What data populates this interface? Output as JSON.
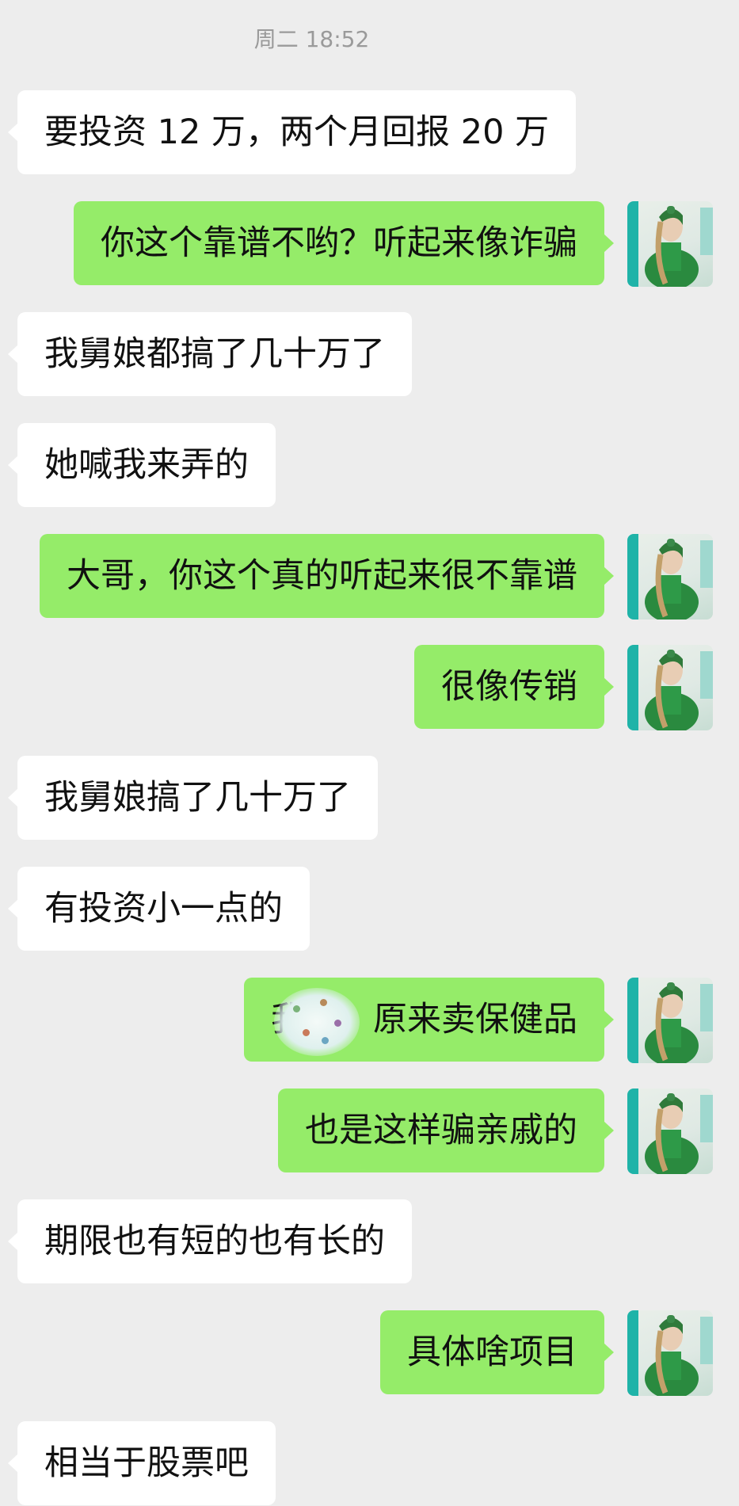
{
  "header": {
    "timestamp": "周二 18:52"
  },
  "colors": {
    "background": "#ededed",
    "incoming_bubble": "#ffffff",
    "outgoing_bubble": "#95ec69",
    "timestamp": "#9a9a9a"
  },
  "avatar": {
    "icon": "user-avatar-icon",
    "description_hidden": true
  },
  "messages": [
    {
      "side": "in",
      "text": "要投资 12 万，两个月回报 20 万"
    },
    {
      "side": "out",
      "text": "你这个靠谱不哟？听起来像诈骗"
    },
    {
      "side": "in",
      "text": "我舅娘都搞了几十万了"
    },
    {
      "side": "in",
      "text": "她喊我来弄的"
    },
    {
      "side": "out",
      "text": "大哥，你这个真的听起来很不靠谱"
    },
    {
      "side": "out",
      "text": "很像传销"
    },
    {
      "side": "in",
      "text": "我舅娘搞了几十万了"
    },
    {
      "side": "in",
      "text": "有投资小一点的"
    },
    {
      "side": "out",
      "text": "我　　原来卖保健品"
    },
    {
      "side": "out",
      "text": "也是这样骗亲戚的"
    },
    {
      "side": "in",
      "text": "期限也有短的也有长的"
    },
    {
      "side": "out",
      "text": "具体啥项目"
    },
    {
      "side": "in",
      "text": "相当于股票吧"
    }
  ]
}
